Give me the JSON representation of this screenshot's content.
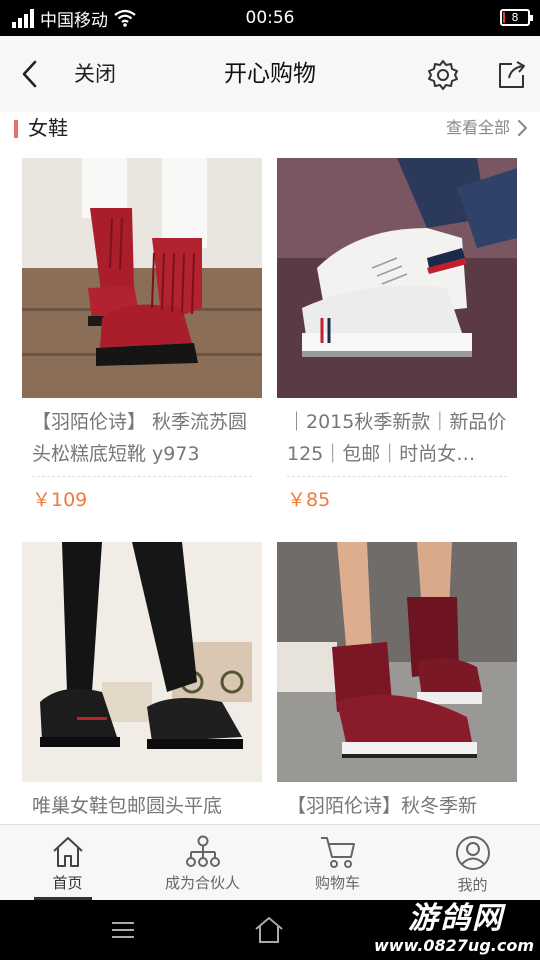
{
  "status_bar": {
    "carrier": "中国移动",
    "time": "00:56",
    "battery": "8",
    "battery_level": 0.08
  },
  "nav": {
    "close_label": "关闭",
    "title": "开心购物"
  },
  "section": {
    "title": "女鞋",
    "view_all": "查看全部"
  },
  "products": [
    {
      "title": "【羽陌伦诗】 秋季流苏圆头松糕底短靴 y973",
      "price": "￥109"
    },
    {
      "title": "｜2015秋季新款｜新品价125｜包邮｜时尚女…",
      "price": "￥85"
    },
    {
      "title": "唯巢女鞋包邮圆头平底",
      "price": ""
    },
    {
      "title": "【羽陌伦诗】秋冬季新",
      "price": ""
    }
  ],
  "tabs": [
    {
      "label": "首页"
    },
    {
      "label": "成为合伙人"
    },
    {
      "label": "购物车"
    },
    {
      "label": "我的"
    }
  ],
  "watermark": {
    "name": "游鸽网",
    "url": "www.0827ug.com"
  },
  "colors": {
    "accent": "#e57373",
    "price": "#f07b3a",
    "status_bar": "#000000",
    "nav_bg": "#f7f7f7"
  }
}
